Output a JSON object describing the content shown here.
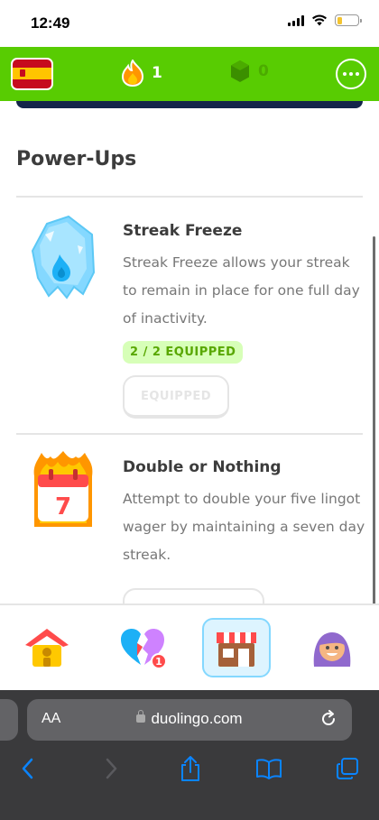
{
  "status_bar": {
    "time": "12:49"
  },
  "top_bar": {
    "flag": "spain-flag-icon",
    "streak_count": "1",
    "gem_count": "0",
    "colors": {
      "green": "#58cc02",
      "flame": "#ff9600"
    }
  },
  "content": {
    "section_title": "Power-Ups",
    "items": [
      {
        "icon": "streak-freeze-icon",
        "title": "Streak Freeze",
        "description": "Streak Freeze allows your streak to remain in place for one full day of inactivity.",
        "badge": "2 / 2 EQUIPPED",
        "button": "EQUIPPED"
      },
      {
        "icon": "calendar-flame-icon",
        "title": "Double or Nothing",
        "description": "Attempt to double your five lingot wager by maintaining a seven day streak."
      }
    ]
  },
  "tabs": [
    {
      "icon": "home-icon",
      "active": false
    },
    {
      "icon": "broken-heart-icon",
      "badge": "1",
      "active": false
    },
    {
      "icon": "shop-icon",
      "active": true
    },
    {
      "icon": "profile-avatar-icon",
      "active": false
    }
  ],
  "safari": {
    "aa_label": "AA",
    "url": "duolingo.com"
  }
}
